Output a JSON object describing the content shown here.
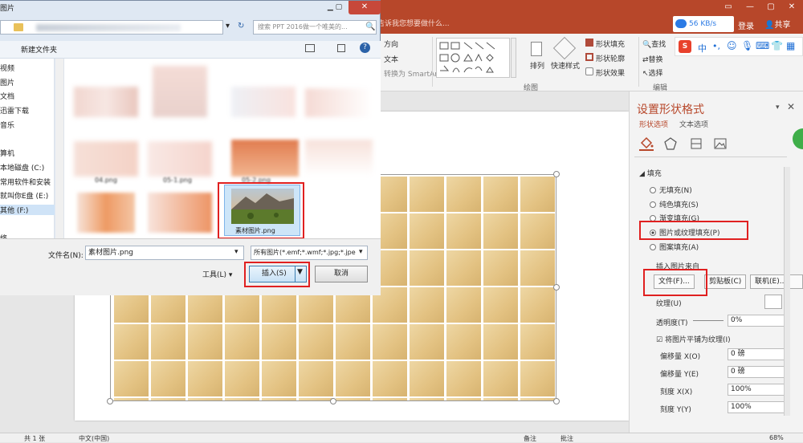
{
  "window": {
    "tell_me": "告诉我您想要做什么...",
    "login": "登录",
    "share": "共享",
    "net_speed": "56 KB/s"
  },
  "ribbon": {
    "direction": "方向",
    "text_label": "文本",
    "smartart": "转换为 SmartArt",
    "arrange": "排列",
    "quick_styles": "快速样式",
    "shape_fill": "形状填充",
    "shape_outline": "形状轮廓",
    "shape_effects": "形状效果",
    "find": "查找",
    "replace": "替换",
    "select": "选择",
    "group_drawing": "绘图",
    "group_editing": "编辑"
  },
  "ime": {
    "logo": "S",
    "lang": "中"
  },
  "pane": {
    "title": "设置形状格式",
    "tab_shape": "形状选项",
    "tab_text": "文本选项",
    "fill_header": "填充",
    "radio_none": "无填充(N)",
    "radio_solid": "纯色填充(S)",
    "radio_gradient": "渐变填充(G)",
    "radio_picture": "图片或纹理填充(P)",
    "radio_pattern": "图案填充(A)",
    "insert_from": "插入图片来自",
    "btn_file": "文件(F)...",
    "btn_clipboard": "剪贴板(C)",
    "btn_online": "联机(E)...",
    "texture": "纹理(U)",
    "transparency": "透明度(T)",
    "transparency_value": "0%",
    "tile_checkbox": "将图片平铺为纹理(I)",
    "offset_x": "偏移量 X(O)",
    "offset_x_value": "0 磅",
    "offset_y": "偏移量 Y(E)",
    "offset_y_value": "0 磅",
    "scale_x": "刻度 X(X)",
    "scale_x_value": "100%",
    "scale_y": "刻度 Y(Y)",
    "scale_y_value": "100%"
  },
  "status": {
    "slide": "共 1 张",
    "language": "中文(中国)",
    "notes": "备注",
    "comments": "批注",
    "zoom": "68%"
  },
  "dialog": {
    "title": "图片",
    "search_placeholder": "搜索 PPT 2016做一个唯美的...",
    "new_folder": "新建文件夹",
    "nav": [
      "视频",
      "图片",
      "文档",
      "迅雷下载",
      "音乐",
      "算机",
      "本地磁盘 (C:)",
      "常用软件和安装",
      "就叫你E盘 (E:)",
      "其他 (F:)",
      "络"
    ],
    "files": [
      "04.png",
      "05-1.png",
      "05-2.png",
      "素材图片.png"
    ],
    "filename_label": "文件名(N):",
    "filename_value": "素材图片.png",
    "filetype_value": "所有图片(*.emf;*.wmf;*.jpg;*.jpe",
    "tools": "工具(L)",
    "insert": "插入(S)",
    "cancel": "取消"
  }
}
